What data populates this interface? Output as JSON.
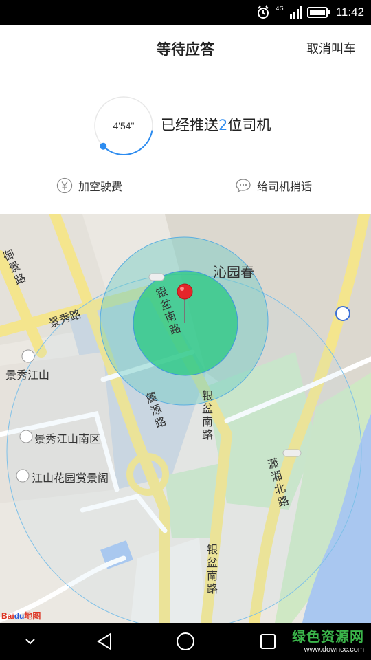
{
  "status_bar": {
    "time": "11:42",
    "network": "4G"
  },
  "header": {
    "title": "等待应答",
    "cancel_label": "取消叫车"
  },
  "waiting": {
    "timer": "4'54\"",
    "timer_progress": 0.35,
    "msg_prefix": "已经推送",
    "driver_count": "2",
    "msg_suffix": "位司机",
    "accent_color": "#2d8cf0"
  },
  "actions": {
    "add_fee_label": "加空驶费",
    "add_fee_icon": "yen-icon",
    "message_label": "给司机捎话",
    "message_icon": "chat-icon"
  },
  "map": {
    "places": {
      "qinyuanchun": "沁园春",
      "jingxiu_jiangshan": "景秀江山",
      "jingxiu_jiangshan_south": "景秀江山南区",
      "jiangshan_garden": "江山花园赏景阁"
    },
    "roads": {
      "yujing": "御景路",
      "jingxiu": "景秀路",
      "yinpen_nan_1": "银盆南路",
      "yinpen_nan_2": "银盆南路",
      "yinpen_nan_3": "银盆南路",
      "luyuan": "麓源路",
      "puxiang_bei": "潇湘北路"
    },
    "logo": {
      "part1": "Bai",
      "part2": "du",
      "part3": "地图"
    }
  },
  "nav": {
    "back_icon": "back-triangle-icon",
    "home_icon": "home-circle-icon",
    "recent_icon": "recent-square-icon"
  },
  "watermark": {
    "name": "绿色资源网",
    "url": "www.downcc.com"
  }
}
